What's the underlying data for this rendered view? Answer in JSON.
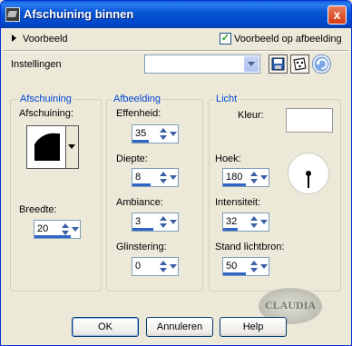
{
  "window": {
    "title": "Afschuining binnen",
    "close_symbol": "x"
  },
  "preview": {
    "label": "Voorbeeld",
    "checkbox_label": "Voorbeeld op afbeelding",
    "checked": true
  },
  "settings": {
    "label": "Instellingen",
    "value": ""
  },
  "groups": {
    "bevel": {
      "title": "Afschuining",
      "shape_label": "Afschuining:",
      "width_label": "Breedte:",
      "width_value": "20",
      "width_fraction": 0.8
    },
    "image": {
      "title": "Afbeelding",
      "smoothness_label": "Effenheid:",
      "smoothness_value": "35",
      "smoothness_fraction": 0.35,
      "depth_label": "Diepte:",
      "depth_value": "8",
      "depth_fraction": 0.4,
      "ambience_label": "Ambiance:",
      "ambience_value": "3",
      "ambience_fraction": 0.45,
      "shininess_label": "Glinstering:",
      "shininess_value": "0",
      "shininess_fraction": 0.0
    },
    "light": {
      "title": "Licht",
      "color_label": "Kleur:",
      "color": "#ffffff",
      "angle_label": "Hoek:",
      "angle_value": "180",
      "angle_fraction": 0.5,
      "intensity_label": "Intensiteit:",
      "intensity_value": "32",
      "intensity_fraction": 0.32,
      "source_label": "Stand lichtbron:",
      "source_value": "50",
      "source_fraction": 0.5
    }
  },
  "buttons": {
    "ok": "OK",
    "cancel": "Annuleren",
    "help": "Help"
  },
  "watermark": "CLAUDIA"
}
